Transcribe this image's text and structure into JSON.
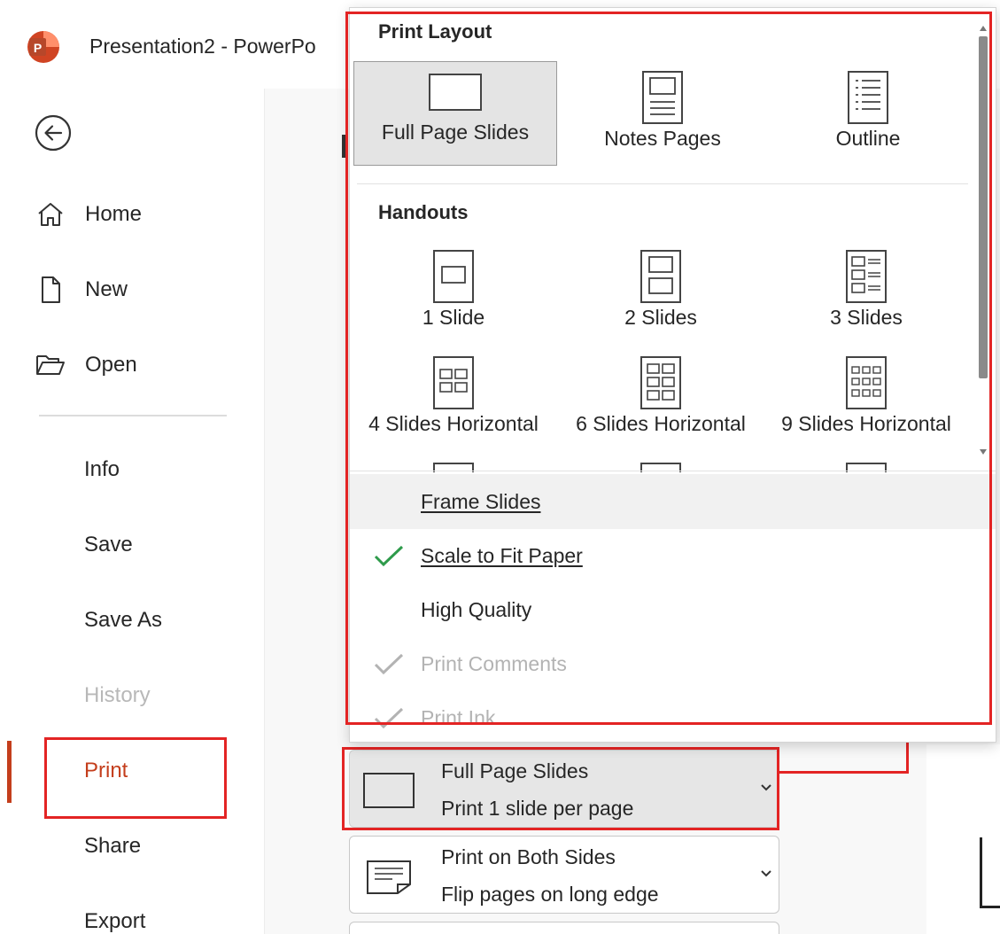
{
  "app": {
    "title": "Presentation2  -  PowerPo",
    "icon": "powerpoint-app-icon",
    "brand_color": "#c43e1c"
  },
  "nav": {
    "back_icon": "back-arrow-icon",
    "items": [
      {
        "label": "Home",
        "icon": "home-icon"
      },
      {
        "label": "New",
        "icon": "new-document-icon"
      },
      {
        "label": "Open",
        "icon": "folder-open-icon"
      }
    ],
    "secondary": [
      {
        "label": "Info",
        "state": "normal"
      },
      {
        "label": "Save",
        "state": "normal"
      },
      {
        "label": "Save As",
        "state": "normal"
      },
      {
        "label": "History",
        "state": "disabled"
      },
      {
        "label": "Print",
        "state": "active"
      },
      {
        "label": "Share",
        "state": "normal"
      },
      {
        "label": "Export",
        "state": "normal"
      }
    ]
  },
  "dropdown": {
    "print_layout_heading": "Print Layout",
    "layouts": [
      {
        "label": "Full Page Slides",
        "icon": "full-page-slides-icon",
        "selected": true
      },
      {
        "label": "Notes Pages",
        "icon": "notes-pages-icon",
        "selected": false
      },
      {
        "label": "Outline",
        "icon": "outline-icon",
        "selected": false
      }
    ],
    "handouts_heading": "Handouts",
    "handouts": [
      {
        "label": "1 Slide",
        "icon": "handout-1-slide-icon"
      },
      {
        "label": "2 Slides",
        "icon": "handout-2-slides-icon"
      },
      {
        "label": "3 Slides",
        "icon": "handout-3-slides-icon"
      },
      {
        "label": "4 Slides Horizontal",
        "icon": "handout-4-slides-horizontal-icon"
      },
      {
        "label": "6 Slides Horizontal",
        "icon": "handout-6-slides-horizontal-icon"
      },
      {
        "label": "9 Slides Horizontal",
        "icon": "handout-9-slides-horizontal-icon"
      }
    ],
    "options": [
      {
        "label": "Frame Slides",
        "checked": false,
        "enabled": true,
        "hover": true
      },
      {
        "label": "Scale to Fit Paper",
        "checked": true,
        "enabled": true,
        "hover": false
      },
      {
        "label": "High Quality",
        "checked": false,
        "enabled": true,
        "hover": false
      },
      {
        "label": "Print Comments",
        "checked": true,
        "enabled": false,
        "hover": false
      },
      {
        "label": "Print Ink",
        "checked": true,
        "enabled": false,
        "hover": false
      }
    ],
    "check_color": "#2e9b4b"
  },
  "settings": {
    "layout": {
      "title": "Full Page Slides",
      "subtitle": "Print 1 slide per page",
      "icon": "slide-layout-icon"
    },
    "sides": {
      "title": "Print on Both Sides",
      "subtitle": "Flip pages on long edge",
      "icon": "duplex-print-icon"
    }
  },
  "highlight_color": "#e32424"
}
